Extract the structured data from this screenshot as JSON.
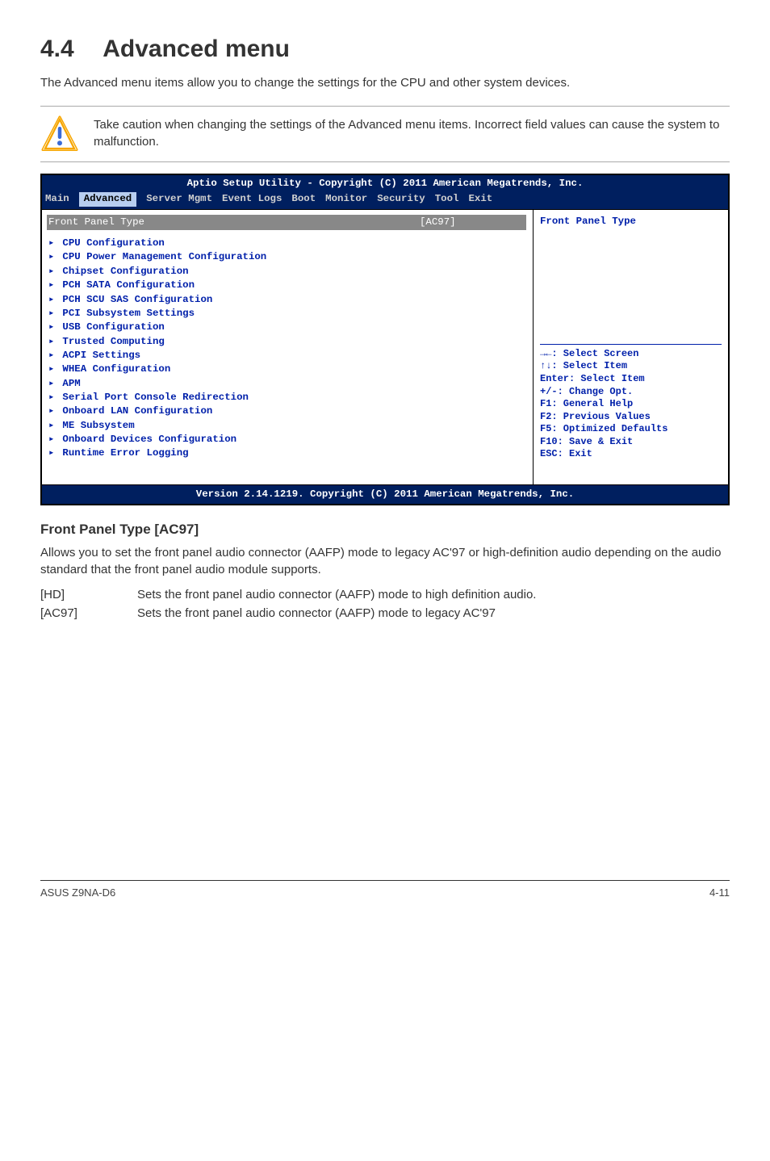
{
  "heading_num": "4.4",
  "heading_title": "Advanced menu",
  "intro": "The Advanced menu items allow you to change the settings for the CPU and other system devices.",
  "warning": "Take caution when changing the settings of the Advanced menu items. Incorrect field values can cause the system to malfunction.",
  "bios": {
    "title": "Aptio Setup Utility - Copyright (C) 2011 American Megatrends, Inc.",
    "menu": [
      "Main",
      "Advanced",
      "Server Mgmt",
      "Event Logs",
      "Boot",
      "Monitor",
      "Security",
      "Tool",
      "Exit"
    ],
    "active_menu_index": 1,
    "selected_label": "Front Panel Type",
    "selected_value": "[AC97]",
    "items": [
      "CPU Configuration",
      "CPU Power Management Configuration",
      "Chipset Configuration",
      "PCH SATA Configuration",
      "PCH SCU SAS Configuration",
      "PCI Subsystem Settings",
      "USB Configuration",
      "Trusted Computing",
      "ACPI Settings",
      "WHEA Configuration",
      "APM",
      "Serial Port Console Redirection",
      "Onboard LAN Configuration",
      "ME Subsystem",
      "Onboard Devices Configuration",
      "Runtime Error Logging"
    ],
    "right_title": "Front Panel Type",
    "help": [
      "→←: Select Screen",
      "↑↓:  Select Item",
      "Enter: Select Item",
      "+/-: Change Opt.",
      "F1: General Help",
      "F2: Previous Values",
      "F5: Optimized Defaults",
      "F10: Save & Exit",
      "ESC: Exit"
    ],
    "footer": "Version 2.14.1219. Copyright (C) 2011 American Megatrends, Inc."
  },
  "front_heading": "Front Panel Type [AC97]",
  "front_body": "Allows you to set the front panel audio connector (AAFP) mode to legacy AC'97 or high-definition audio depending on the audio standard that the front panel audio module supports.",
  "options": [
    {
      "key": "[HD]",
      "val": "Sets the front panel audio connector (AAFP) mode to high definition audio."
    },
    {
      "key": "[AC97]",
      "val": "Sets the front panel audio connector (AAFP) mode to legacy AC'97"
    }
  ],
  "footer_left": "ASUS Z9NA-D6",
  "footer_right": "4-11"
}
